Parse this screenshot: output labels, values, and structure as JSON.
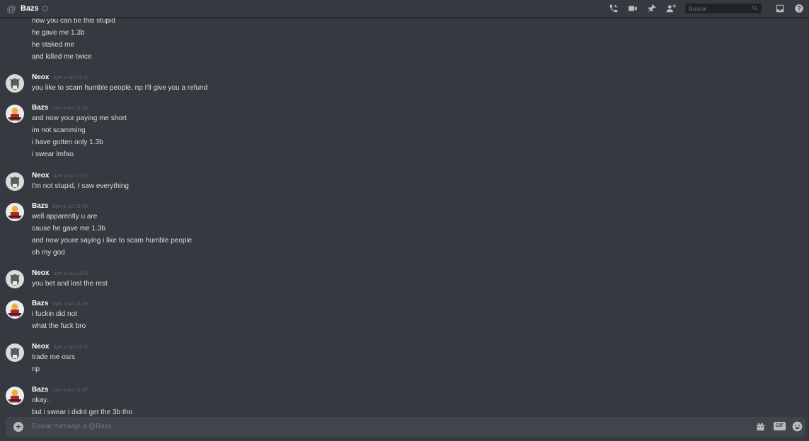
{
  "header": {
    "channel_name": "Bazs",
    "search_placeholder": "Buscar"
  },
  "icons": {
    "at": "at-icon",
    "call": "phone-call-icon",
    "video": "video-camera-icon",
    "pin": "pin-icon",
    "add_user": "add-friend-icon",
    "search": "search-icon",
    "inbox": "inbox-icon",
    "help": "help-icon",
    "attach": "plus-circle-icon",
    "gift": "gift-icon",
    "emoji": "emoji-icon"
  },
  "messages": {
    "orphan_lines": [
      "now you can be this stupid",
      "he gave me 1.3b",
      "he staked me",
      "and killed me twice"
    ],
    "groups": [
      {
        "author": "Neox",
        "timestamp": "ayer a las 21:05",
        "lines": [
          "you like to scam humble people, np I'll give you a refund"
        ]
      },
      {
        "author": "Bazs",
        "timestamp": "ayer a las 21:05",
        "lines": [
          "and now your paying me short",
          "im not scamming",
          "i have gotten only 1.3b",
          "i swear lmfao"
        ]
      },
      {
        "author": "Neox",
        "timestamp": "ayer a las 21:05",
        "lines": [
          "I'm not stupid, I saw everything"
        ]
      },
      {
        "author": "Bazs",
        "timestamp": "ayer a las 21:06",
        "lines": [
          "well apparently u are",
          "cause he gave me 1.3b",
          "and now youre saying i like to scam humble people",
          "oh my god"
        ]
      },
      {
        "author": "Neox",
        "timestamp": "ayer a las 21:06",
        "lines": [
          "you bet and lost the rest"
        ]
      },
      {
        "author": "Bazs",
        "timestamp": "ayer a las 21:06",
        "lines": [
          "i fuckin did not",
          "what the fuck bro"
        ]
      },
      {
        "author": "Neox",
        "timestamp": "ayer a las 21:06",
        "lines": [
          "trade me osrs",
          "np"
        ]
      },
      {
        "author": "Bazs",
        "timestamp": "ayer a las 21:07",
        "lines": [
          "okay..",
          "but i swear i didnt get the 3b tho"
        ]
      }
    ]
  },
  "composer": {
    "placeholder": "Enviar mensaje a @Bazs",
    "gif_label": "GIF"
  }
}
